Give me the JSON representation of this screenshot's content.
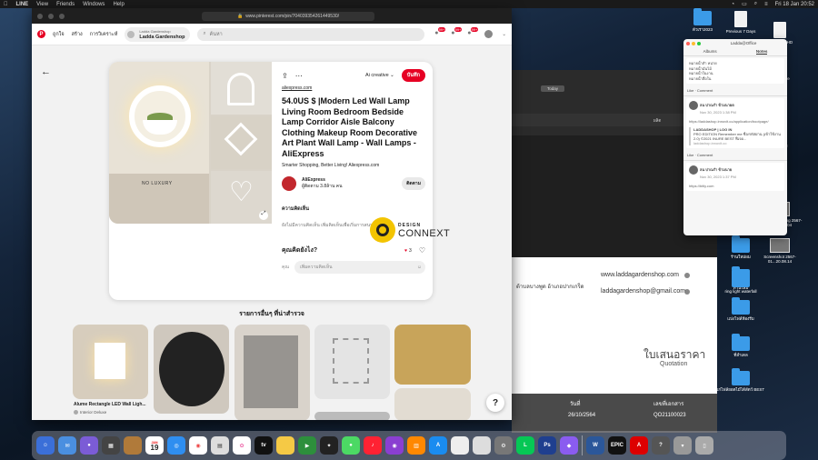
{
  "menubar": {
    "app": "LINE",
    "items": [
      "View",
      "Friends",
      "Windows",
      "Help"
    ],
    "clock": "Fri 18 Jan  20:52"
  },
  "browser": {
    "url": "www.pinterest.com/pin/704039354261449530/"
  },
  "pinterest": {
    "nav": [
      "ถูกใจ",
      "สร้าง",
      "การวิเคราะห์"
    ],
    "board_line1": "Ladda Gardenshop",
    "board_line2": "Ladda Gardenshop",
    "search_placeholder": "ค้นหา",
    "badges": [
      "99+",
      "99+",
      "99+"
    ],
    "pin": {
      "board_select": "Ai creative",
      "save": "บันทึก",
      "domain": "aliexpress.com",
      "title": "54.0US $ |Modern Led Wall Lamp Living Room Bedroom Bedside Lamp Corridor Aisle Balcony Clothing Makeup Room Decorative Art Plant Wall Lamp - Wall Lamps - AliExpress",
      "subtitle": "Smarter Shopping, Better Living! Aliexpress.com",
      "owner_name": "AliExpress",
      "owner_followers": "ผู้ติดตาม 3.8ล้าน คน",
      "follow": "ติดตาม",
      "comments_heading": "ความคิดเห็น",
      "comments_empty": "ยังไม่มีความคิดเห็น เพิ่มคิดเห็นเพื่อเริ่มการสนทนา",
      "prompt": "คุณคิดยังไง?",
      "reactions": "3",
      "you_label": "คุณ",
      "comment_placeholder": "เพิ่มความคิดเห็น",
      "image_text": "NO LUXURY"
    },
    "more_heading": "รายการอื่นๆ ที่น่าสำรวจ",
    "tiles": [
      {
        "caption": "Alume Rectangle LED Wall Ligh...",
        "source": "Interior Deluxe"
      }
    ],
    "help": "?"
  },
  "watermark": {
    "top": "DESIGN",
    "bottom": "CONNEXT"
  },
  "quotation": {
    "website": "www.laddagardenshop.com",
    "email": "laddagardenshop@gmail.com",
    "address": "ต้าบลบางพูด อ้าเภอปากเกร็ด",
    "thai_title": "ใบเสนอราคา",
    "en_title": "Quotation",
    "date_label": "วันที่",
    "date": "26/10/2564",
    "no_label": "เลขที่เอกสาร",
    "no": "QO21100023"
  },
  "bg_app": {
    "today": "Today",
    "label": "ผลิต"
  },
  "notes_window": {
    "title": "Ladda@Office",
    "tabs": [
      "Albums",
      "Notes"
    ],
    "lines": [
      "หมายน้ำสำ หน่าย",
      "หมายน้ำมั่นไม้",
      "หมายน้ำในงาน",
      "หมายน้ำสื่อใน"
    ],
    "like_comment": "Like · Comment",
    "post1_name": "ลน ปาณรำ ข้ามนายด",
    "post1_date": "Nov 30, 2023 1:38 PM",
    "link1": "https://laddashop.innovit.co/application/bootpage/",
    "card_title": "LADDASHOP | LOG IN",
    "card_text": "PRO EDITION Remember me ชื่อ/รหัสผ่าน (เข้าใช้งาน 2.0) ©2021 INURE BEST ฟีเจอ...",
    "card_domain": "laddashop.innovit.co",
    "post2_name": "ลน ปาณรำ ข้ามนาย",
    "post2_date": "Nov 30, 2023 1:37 PM",
    "link2": "https://bitly.com"
  },
  "desktop": [
    {
      "label": "ตัวเรา2023",
      "kind": "folder"
    },
    {
      "label": "Previous 7 Days",
      "kind": "doc"
    },
    {
      "label": "Macintosh HD",
      "kind": "doc"
    },
    {
      "label": "Hard Drive",
      "kind": "doc"
    },
    {
      "label": "Untitled",
      "kind": "doc"
    },
    {
      "label": "T-PHON",
      "kind": "doc"
    },
    {
      "label": "Today",
      "kind": "doc"
    },
    {
      "label": "Screen Recording 2567-01...20.31.04",
      "kind": "thumb"
    },
    {
      "label": "ร้านใหม่ผม",
      "kind": "folder"
    },
    {
      "label": "Screenshot 2567-01...20.08.14",
      "kind": "thumb"
    },
    {
      "label": "ท่านใหม่",
      "kind": "folder"
    },
    {
      "label": "ring light waterfall",
      "kind": "folder"
    },
    {
      "label": "แบ่งไฟล์ห้องรีม",
      "kind": "folder"
    },
    {
      "label": "ที่ลำเดล",
      "kind": "folder"
    },
    {
      "label": "เก่ไฟล์ยอดไม้ได้สัตว์ BEST",
      "kind": "folder"
    }
  ],
  "dock_tv": "tv",
  "dock_epic": "EPIC",
  "dock_calendar": {
    "month": "JAN",
    "day": "19"
  }
}
